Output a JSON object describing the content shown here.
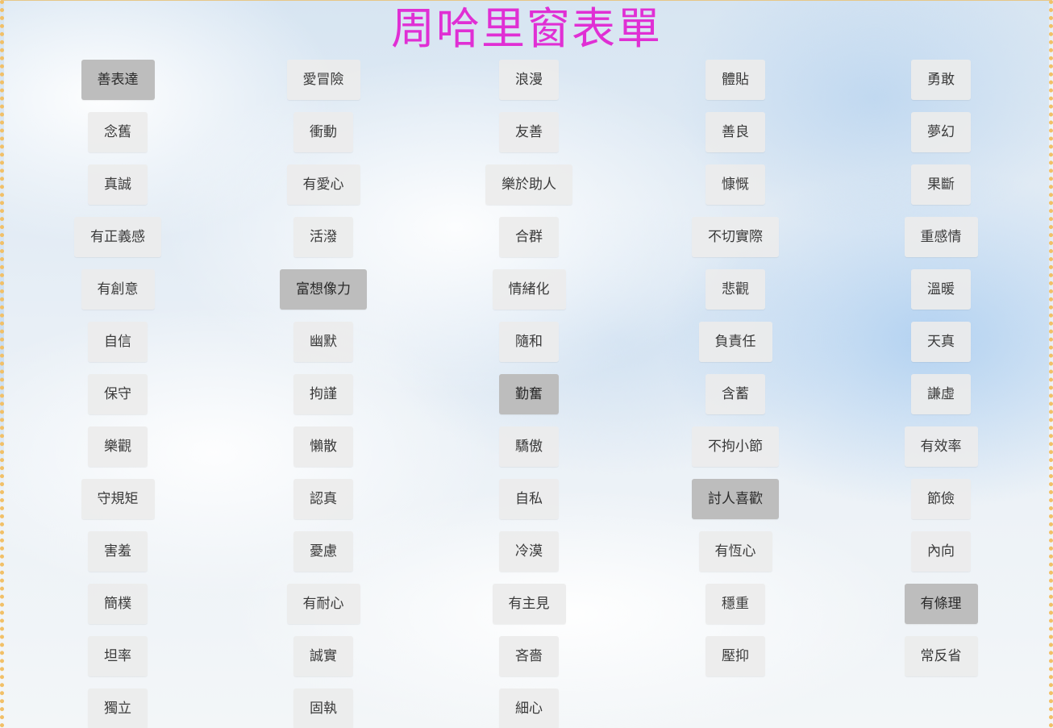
{
  "title": "周哈里窗表單",
  "columns": [
    {
      "items": [
        {
          "label": "善表達",
          "selected": true
        },
        {
          "label": "念舊",
          "selected": false
        },
        {
          "label": "真誠",
          "selected": false
        },
        {
          "label": "有正義感",
          "selected": false
        },
        {
          "label": "有創意",
          "selected": false
        },
        {
          "label": "自信",
          "selected": false
        },
        {
          "label": "保守",
          "selected": false
        },
        {
          "label": "樂觀",
          "selected": false
        },
        {
          "label": "守規矩",
          "selected": false
        },
        {
          "label": "害羞",
          "selected": false
        },
        {
          "label": "簡樸",
          "selected": false
        },
        {
          "label": "坦率",
          "selected": false
        },
        {
          "label": "獨立",
          "selected": false
        }
      ]
    },
    {
      "items": [
        {
          "label": "愛冒險",
          "selected": false
        },
        {
          "label": "衝動",
          "selected": false
        },
        {
          "label": "有愛心",
          "selected": false
        },
        {
          "label": "活潑",
          "selected": false
        },
        {
          "label": "富想像力",
          "selected": true
        },
        {
          "label": "幽默",
          "selected": false
        },
        {
          "label": "拘謹",
          "selected": false
        },
        {
          "label": "懶散",
          "selected": false
        },
        {
          "label": "認真",
          "selected": false
        },
        {
          "label": "憂慮",
          "selected": false
        },
        {
          "label": "有耐心",
          "selected": false
        },
        {
          "label": "誠實",
          "selected": false
        },
        {
          "label": "固執",
          "selected": false
        }
      ]
    },
    {
      "items": [
        {
          "label": "浪漫",
          "selected": false
        },
        {
          "label": "友善",
          "selected": false
        },
        {
          "label": "樂於助人",
          "selected": false
        },
        {
          "label": "合群",
          "selected": false
        },
        {
          "label": "情緒化",
          "selected": false
        },
        {
          "label": "隨和",
          "selected": false
        },
        {
          "label": "勤奮",
          "selected": true
        },
        {
          "label": "驕傲",
          "selected": false
        },
        {
          "label": "自私",
          "selected": false
        },
        {
          "label": "冷漠",
          "selected": false
        },
        {
          "label": "有主見",
          "selected": false
        },
        {
          "label": "吝嗇",
          "selected": false
        },
        {
          "label": "細心",
          "selected": false
        }
      ]
    },
    {
      "items": [
        {
          "label": "體貼",
          "selected": false
        },
        {
          "label": "善良",
          "selected": false
        },
        {
          "label": "慷慨",
          "selected": false
        },
        {
          "label": "不切實際",
          "selected": false
        },
        {
          "label": "悲觀",
          "selected": false
        },
        {
          "label": "負責任",
          "selected": false
        },
        {
          "label": "含蓄",
          "selected": false
        },
        {
          "label": "不拘小節",
          "selected": false
        },
        {
          "label": "討人喜歡",
          "selected": true
        },
        {
          "label": "有恆心",
          "selected": false
        },
        {
          "label": "穩重",
          "selected": false
        },
        {
          "label": "壓抑",
          "selected": false
        }
      ]
    },
    {
      "items": [
        {
          "label": "勇敢",
          "selected": false
        },
        {
          "label": "夢幻",
          "selected": false
        },
        {
          "label": "果斷",
          "selected": false
        },
        {
          "label": "重感情",
          "selected": false
        },
        {
          "label": "溫暖",
          "selected": false
        },
        {
          "label": "天真",
          "selected": false
        },
        {
          "label": "謙虛",
          "selected": false
        },
        {
          "label": "有效率",
          "selected": false
        },
        {
          "label": "節儉",
          "selected": false
        },
        {
          "label": "內向",
          "selected": false
        },
        {
          "label": "有條理",
          "selected": true
        },
        {
          "label": "常反省",
          "selected": false
        }
      ]
    }
  ]
}
